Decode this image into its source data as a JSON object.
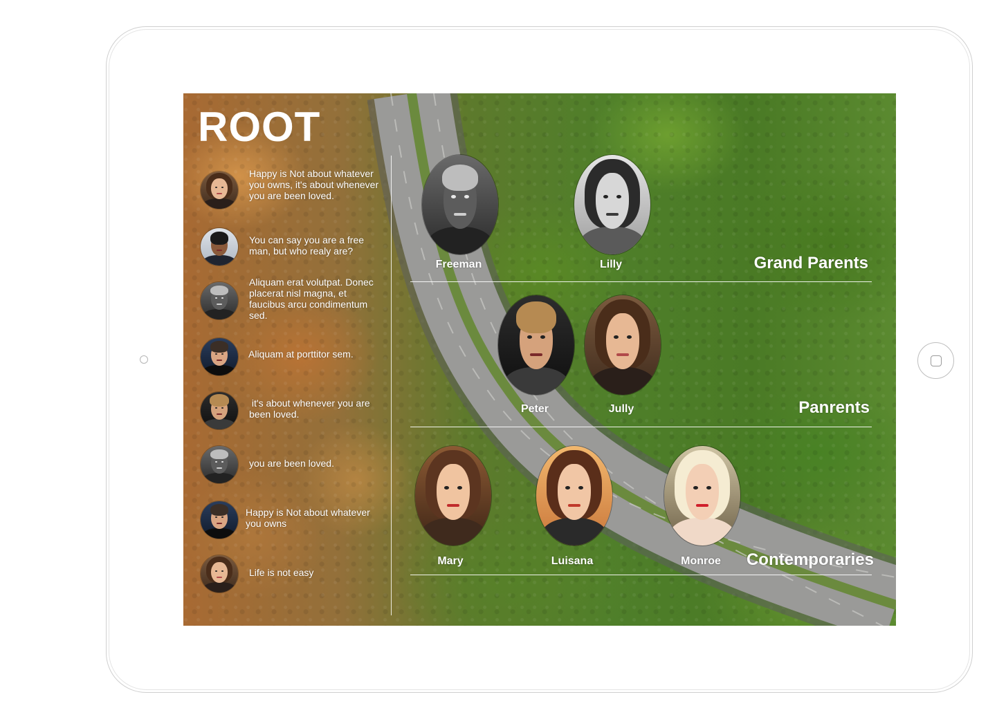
{
  "title": "ROOT",
  "messages": [
    {
      "avatar": "avatar-woman-brunette",
      "text": "Happy is Not about whatever you owns, it's about whenever you are been loved."
    },
    {
      "avatar": "avatar-man-suit",
      "text": "You can say you are a free man, but who realy are?"
    },
    {
      "avatar": "avatar-man-elder",
      "text": "Aliquam erat volutpat. Donec placerat nisl magna, et faucibus arcu condimentum sed."
    },
    {
      "avatar": "avatar-man-tuxedo",
      "text": "Aliquam at porttitor sem."
    },
    {
      "avatar": "avatar-man-blond",
      "text": " it's about whenever you are been loved."
    },
    {
      "avatar": "avatar-man-elder",
      "text": "you are been loved."
    },
    {
      "avatar": "avatar-man-tuxedo",
      "text": "Happy is Not about whatever you owns"
    },
    {
      "avatar": "avatar-woman-brunette",
      "text": "Life is not easy"
    }
  ],
  "generations": [
    {
      "label": "Grand Parents",
      "members": [
        {
          "name": "Freeman"
        },
        {
          "name": "Lilly"
        }
      ]
    },
    {
      "label": "Panrents",
      "members": [
        {
          "name": "Peter"
        },
        {
          "name": "Jully"
        }
      ]
    },
    {
      "label": "Contemporaries",
      "members": [
        {
          "name": "Mary"
        },
        {
          "name": "Luisana"
        },
        {
          "name": "Monroe"
        }
      ]
    }
  ],
  "device": {
    "frame": "tablet",
    "home_button_icon": "square-icon"
  }
}
